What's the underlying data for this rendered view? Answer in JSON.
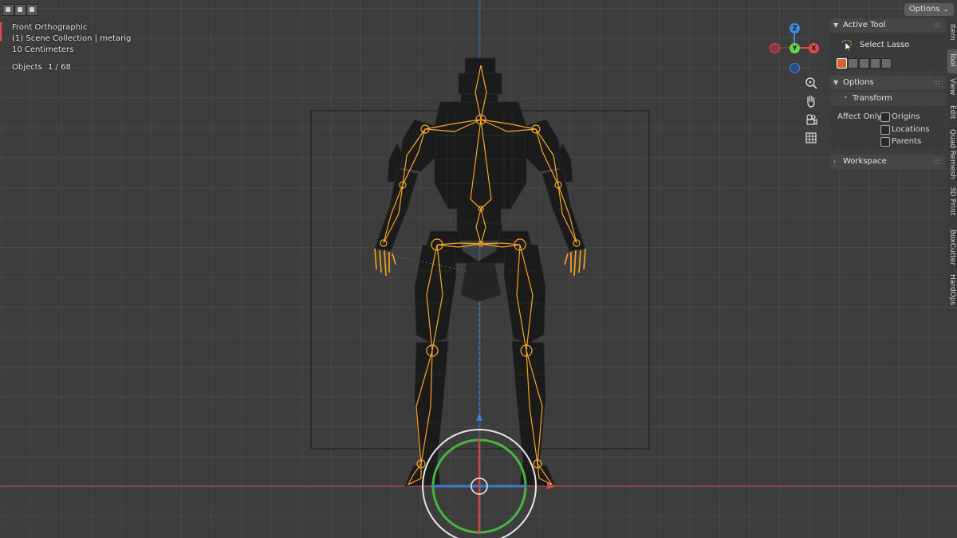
{
  "viewport": {
    "view_name": "Front Orthographic",
    "collection": "(1) Scene Collection | metarig",
    "scale": "10 Centimeters",
    "objects_label": "Objects",
    "objects_count": "1 / 68"
  },
  "header": {
    "options_label": "Options",
    "options_chevron": "⌄"
  },
  "navigation_gizmo": {
    "axes": {
      "z": "Z",
      "y": "Y",
      "x": "X"
    },
    "colors": {
      "x": "#e0484e",
      "y": "#6bd34a",
      "z": "#3f87db"
    },
    "tools": [
      "zoom-icon",
      "hand-icon",
      "camera-icon",
      "grid-icon"
    ]
  },
  "sidebar": {
    "active_tool_title": "Active Tool",
    "active_tool_name": "Select Lasso",
    "options_title": "Options",
    "transform_title": "Transform",
    "affect_only_label": "Affect Only",
    "checkboxes": [
      "Origins",
      "Locations",
      "Parents"
    ],
    "workspace_title": "Workspace",
    "panel_dots": "::::"
  },
  "tabs": [
    "Item",
    "Tool",
    "View",
    "Edit",
    "Quad Remesh",
    "3D Print",
    "BoxCutter",
    "HardOps"
  ],
  "colors": {
    "bone": "#f5a623",
    "mesh": "#1b1b1b",
    "x_axis_line": "#c9474b",
    "z_axis_line": "#3670b8",
    "rotate_ring_green": "#48b543"
  }
}
